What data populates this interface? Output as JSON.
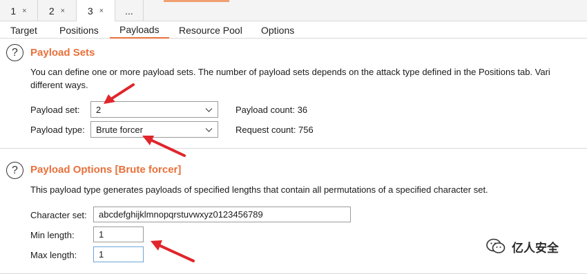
{
  "attack_tabs": [
    {
      "label": "1",
      "close": "×"
    },
    {
      "label": "2",
      "close": "×"
    },
    {
      "label": "3",
      "close": "×"
    },
    {
      "label": "..."
    }
  ],
  "sub_tabs": [
    "Target",
    "Positions",
    "Payloads",
    "Resource Pool",
    "Options"
  ],
  "payload_sets": {
    "help": "?",
    "title": "Payload Sets",
    "description_line1": "You can define one or more payload sets. The number of payload sets depends on the attack type defined in the Positions tab. Vari",
    "description_line2": "different ways.",
    "set_label": "Payload set:",
    "set_value": "2",
    "type_label": "Payload type:",
    "type_value": "Brute forcer",
    "payload_count": "Payload count: 36",
    "request_count": "Request count: 756"
  },
  "payload_options": {
    "help": "?",
    "title": "Payload Options [Brute forcer]",
    "description": "This payload type generates payloads of specified lengths that contain all permutations of a specified character set.",
    "charset_label": "Character set:",
    "charset_value": "abcdefghijklmnopqrstuvwxyz0123456789",
    "min_label": "Min length:",
    "min_value": "1",
    "max_label": "Max length:",
    "max_value": "1"
  },
  "watermark": {
    "text": "亿人安全",
    "icon": "wechat-icon"
  },
  "colors": {
    "accent": "#e8703a",
    "arrow": "#e0252b"
  }
}
